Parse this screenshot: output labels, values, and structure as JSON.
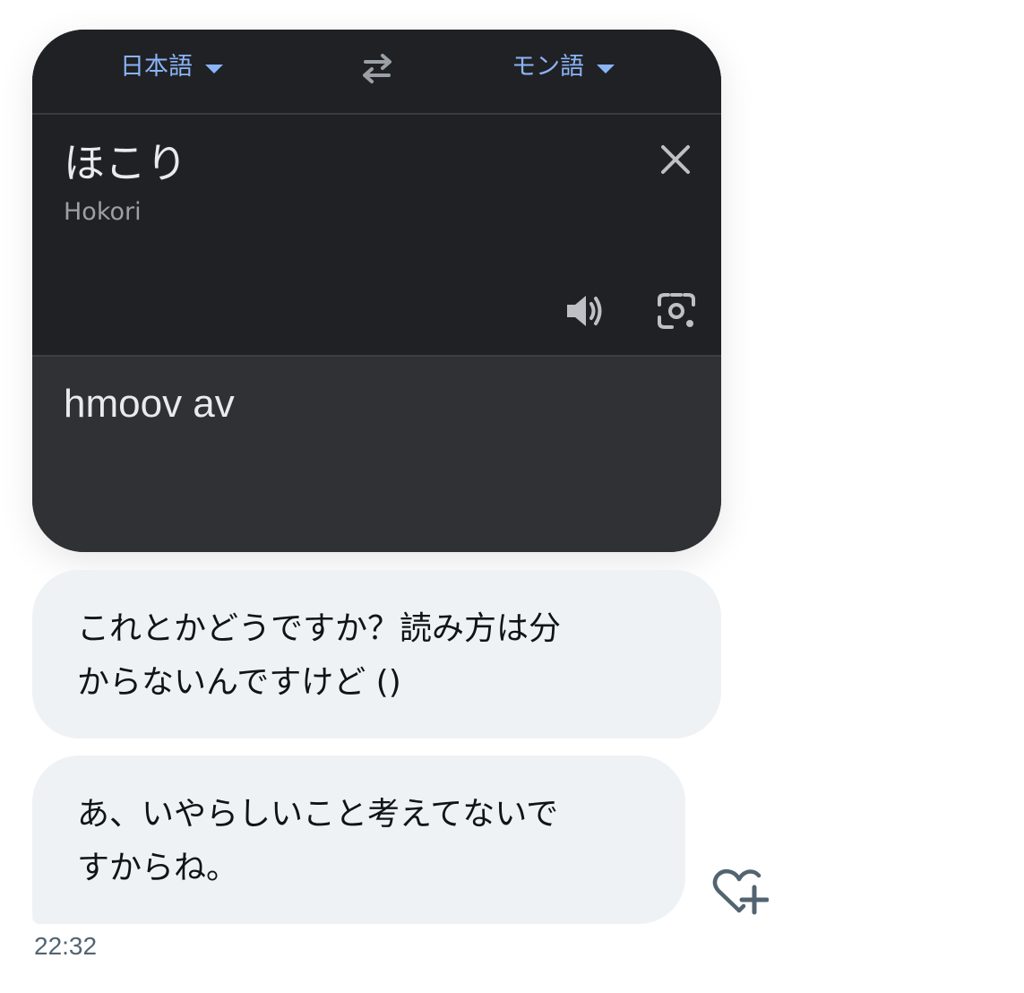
{
  "translate_card": {
    "source_language": "日本語",
    "target_language": "モン語",
    "source_text": "ほこり",
    "romanization": "Hokori",
    "translated_text": "hmoov av",
    "icons": {
      "source_dropdown": "caret-down-icon",
      "target_dropdown": "caret-down-icon",
      "swap": "swap-languages-icon",
      "close": "close-icon",
      "speaker": "speaker-icon",
      "lens": "camera-lens-icon"
    },
    "colors": {
      "card_background": "#202124",
      "output_background": "#303134",
      "accent": "#8ab4f8",
      "text_primary": "#e8eaed",
      "text_secondary": "#9aa0a6"
    }
  },
  "messages": [
    {
      "lines": [
        "これとかどうですか？読み方は分",
        "からないんですけど ()"
      ]
    },
    {
      "lines": [
        "あ、いやらしいこと考えてないで",
        "すからね。"
      ]
    }
  ],
  "react_button": {
    "icon": "heart-plus-icon"
  },
  "timestamp": "22:32",
  "colors": {
    "bubble_background": "#eff2f4",
    "bubble_text": "#0f1419",
    "timestamp_text": "#536471"
  }
}
